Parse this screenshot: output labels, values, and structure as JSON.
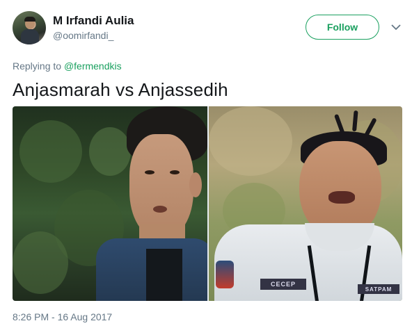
{
  "user": {
    "display_name": "M Irfandi Aulia",
    "handle": "@oomirfandi_"
  },
  "actions": {
    "follow_label": "Follow"
  },
  "reply": {
    "prefix": "Replying to",
    "mention": "@fermendkis"
  },
  "tweet": {
    "text": "Anjasmarah vs Anjassedih",
    "timestamp": "8:26 PM - 16 Aug 2017"
  },
  "media": {
    "photos": [
      {
        "name": "photo-left"
      },
      {
        "name": "photo-right",
        "badge_text": "CECEP",
        "badge2_text": "SATPAM"
      }
    ]
  },
  "colors": {
    "accent": "#1aa05f",
    "secondary_text": "#657786",
    "primary_text": "#14171a"
  },
  "icons": {
    "more_menu": "chevron-down-icon"
  }
}
